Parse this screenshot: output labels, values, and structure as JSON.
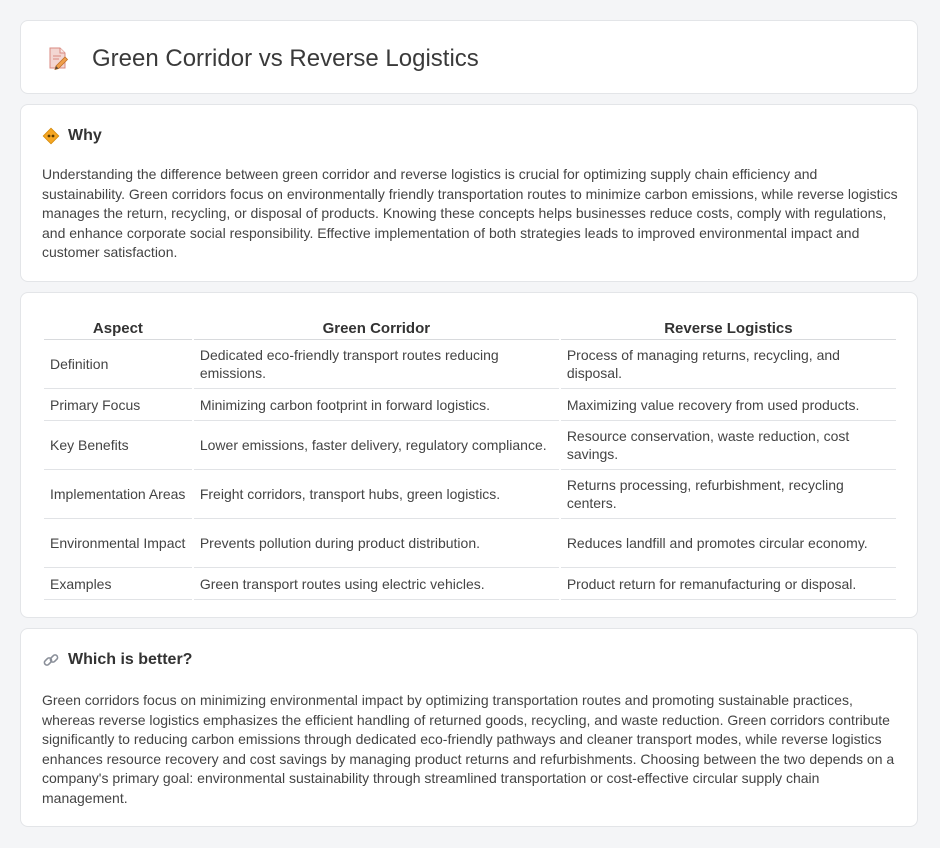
{
  "header": {
    "title": "Green Corridor vs Reverse Logistics",
    "icon": "document-pencil-icon"
  },
  "why": {
    "heading": "Why",
    "icon": "diamond-sign-icon",
    "text": "Understanding the difference between green corridor and reverse logistics is crucial for optimizing supply chain efficiency and sustainability. Green corridors focus on environmentally friendly transportation routes to minimize carbon emissions, while reverse logistics manages the return, recycling, or disposal of products. Knowing these concepts helps businesses reduce costs, comply with regulations, and enhance corporate social responsibility. Effective implementation of both strategies leads to improved environmental impact and customer satisfaction."
  },
  "comparison": {
    "headers": [
      "Aspect",
      "Green Corridor",
      "Reverse Logistics"
    ],
    "rows": [
      [
        "Definition",
        "Dedicated eco-friendly transport routes reducing emissions.",
        "Process of managing returns, recycling, and disposal."
      ],
      [
        "Primary Focus",
        "Minimizing carbon footprint in forward logistics.",
        "Maximizing value recovery from used products."
      ],
      [
        "Key Benefits",
        "Lower emissions, faster delivery, regulatory compliance.",
        "Resource conservation, waste reduction, cost savings."
      ],
      [
        "Implementation Areas",
        "Freight corridors, transport hubs, green logistics.",
        "Returns processing, refurbishment, recycling centers."
      ],
      [
        "Environmental Impact",
        "Prevents pollution during product distribution.",
        "Reduces landfill and promotes circular economy."
      ],
      [
        "Examples",
        "Green transport routes using electric vehicles.",
        "Product return for remanufacturing or disposal."
      ]
    ]
  },
  "better": {
    "heading": "Which is better?",
    "icon": "link-icon",
    "text": "Green corridors focus on minimizing environmental impact by optimizing transportation routes and promoting sustainable practices, whereas reverse logistics emphasizes the efficient handling of returned goods, recycling, and waste reduction. Green corridors contribute significantly to reducing carbon emissions through dedicated eco-friendly pathways and cleaner transport modes, while reverse logistics enhances resource recovery and cost savings by managing product returns and refurbishments. Choosing between the two depends on a company's primary goal: environmental sustainability through streamlined transportation or cost-effective circular supply chain management."
  }
}
